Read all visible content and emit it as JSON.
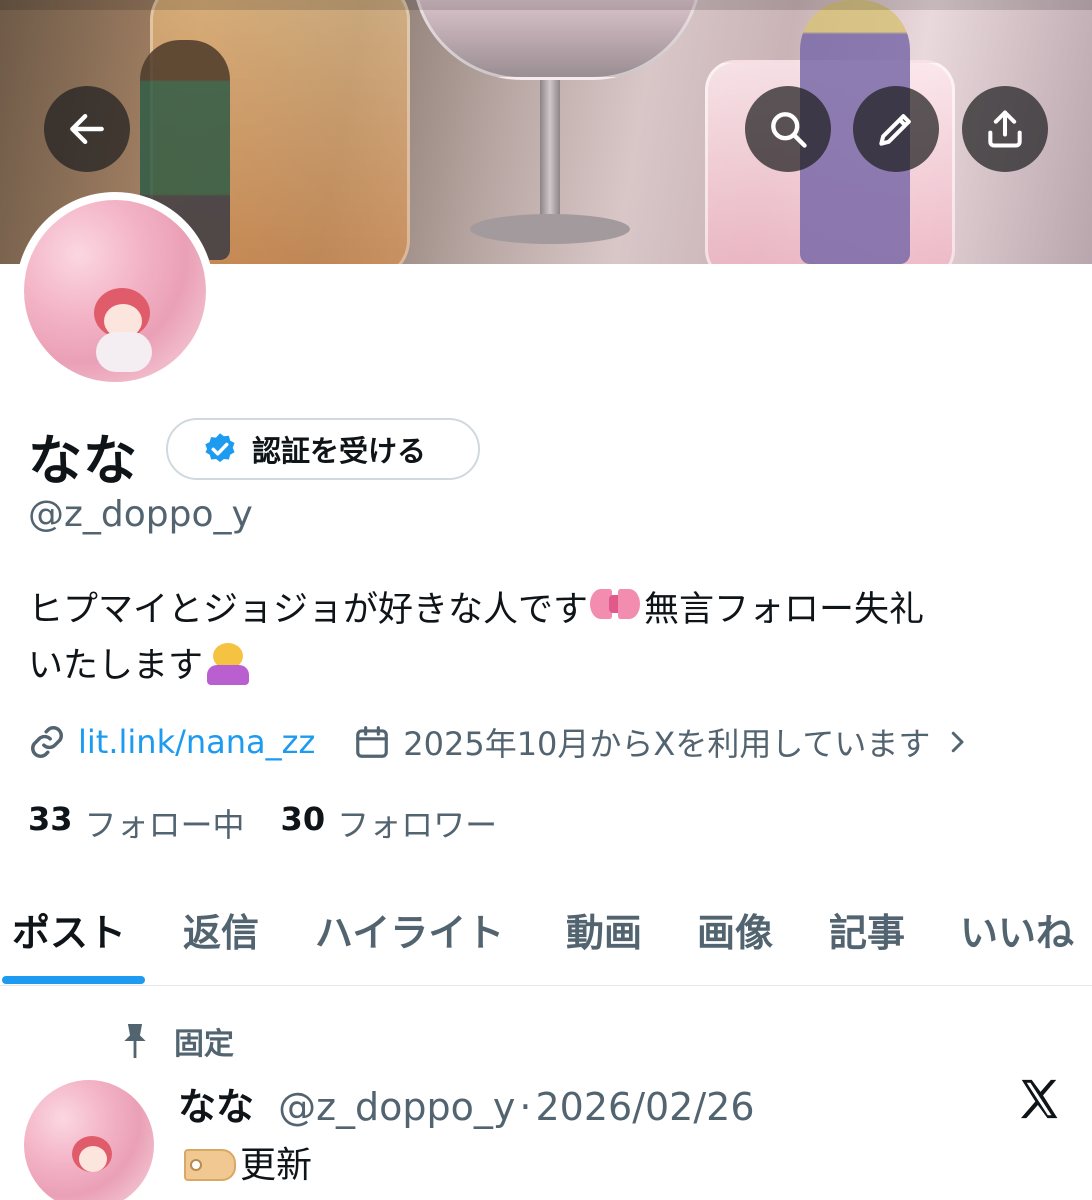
{
  "profile": {
    "display_name": "なな",
    "verify_label": "認証を受ける",
    "handle": "@z_doppo_y",
    "bio_part1": "ヒプマイとジョジョが好きな人です",
    "bio_emoji1": "ribbon",
    "bio_part2": "無言フォロー失礼",
    "bio_part3": "いたします",
    "bio_emoji2": "person-bowing",
    "link": "lit.link/nana_zz",
    "joined": "2025年10月からXを利用しています",
    "following_count": "33",
    "following_label": "フォロー中",
    "followers_count": "30",
    "followers_label": "フォロワー"
  },
  "tabs": [
    {
      "label": "ポスト",
      "active": true
    },
    {
      "label": "返信"
    },
    {
      "label": "ハイライト"
    },
    {
      "label": "動画"
    },
    {
      "label": "画像"
    },
    {
      "label": "記事"
    },
    {
      "label": "いいね"
    }
  ],
  "pinned_post": {
    "pinned_label": "固定",
    "author_name": "なな",
    "author_handle": "@z_doppo_y",
    "separator": "·",
    "date": "2026/02/26",
    "text_emoji": "label-tag",
    "text": "更新"
  },
  "icons": {
    "back": "arrow-left-icon",
    "search": "search-icon",
    "edit": "pencil-icon",
    "share": "share-icon",
    "verified": "verified-badge-icon",
    "link": "link-icon",
    "calendar": "calendar-icon",
    "chevron": "chevron-right-icon",
    "pin": "pin-icon",
    "x_logo": "x-logo-icon"
  },
  "colors": {
    "accent": "#1d9bf0",
    "text": "#0f1419",
    "muted": "#536471",
    "border": "#cfd9de"
  }
}
